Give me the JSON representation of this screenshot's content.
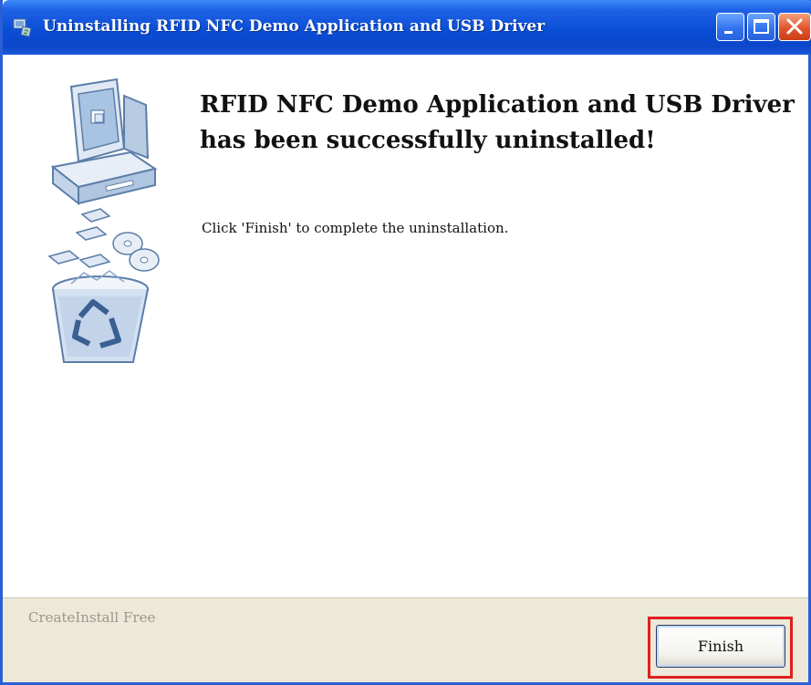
{
  "window": {
    "title": "Uninstalling RFID NFC Demo Application and USB Driver"
  },
  "main": {
    "heading_line1": "RFID NFC Demo Application and USB Driver",
    "heading_line2": "has been successfully uninstalled!",
    "message": "Click 'Finish' to complete the uninstallation.",
    "illustration": "computer-recycle-bin-icon"
  },
  "footer": {
    "brand": "CreateInstall Free",
    "finish_label": "Finish"
  },
  "colors": {
    "titlebar": "#0a4ed6",
    "close_button": "#e0552c",
    "footer_bg": "#ece9d8",
    "highlight": "#e02020"
  }
}
